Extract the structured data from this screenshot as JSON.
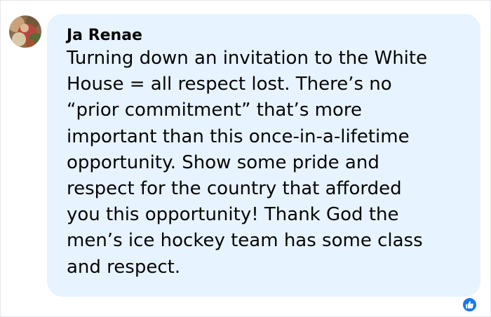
{
  "comment": {
    "author": "Ja Renae",
    "text": "Turning down an invitation to the White\nHouse = all respect lost. There’s no\n“prior commitment” that’s more\nimportant than this once-in-a-lifetime\nopportunity. Show some pride and\nrespect for the country that afforded\nyou this opportunity! Thank God the\nmen’s ice hockey team has some class\nand respect."
  },
  "reaction": {
    "icon": "like-icon",
    "color": "#1877f2"
  },
  "colors": {
    "bubble": "#e7f3ff",
    "text": "#050505"
  }
}
